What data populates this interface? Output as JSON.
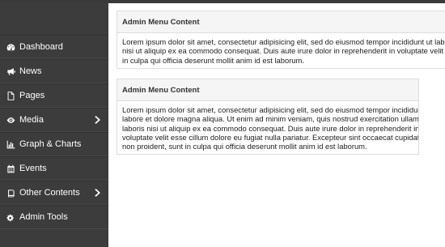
{
  "sidebar": {
    "items": [
      {
        "label": "Dashboard",
        "icon": "dashboard-icon",
        "has_submenu": false
      },
      {
        "label": "News",
        "icon": "bullhorn-icon",
        "has_submenu": false
      },
      {
        "label": "Pages",
        "icon": "file-icon",
        "has_submenu": false
      },
      {
        "label": "Media",
        "icon": "eye-icon",
        "has_submenu": true
      },
      {
        "label": "Graph & Charts",
        "icon": "bar-chart-icon",
        "has_submenu": false
      },
      {
        "label": "Events",
        "icon": "calendar-icon",
        "has_submenu": false
      },
      {
        "label": "Other Contents",
        "icon": "book-icon",
        "has_submenu": true
      },
      {
        "label": "Admin Tools",
        "icon": "cogs-icon",
        "has_submenu": false
      }
    ]
  },
  "panels": [
    {
      "title": "Admin Menu Content",
      "lines": [
        "Lorem ipsum dolor sit amet, consectetur adipisicing elit, sed do eiusmod tempor incididunt ut labore",
        "nisi ut aliquip ex ea commodo consequat. Duis aute irure dolor in reprehenderit in voluptate velit esse",
        "in culpa qui officia deserunt mollit anim id est laborum."
      ]
    },
    {
      "title": "Admin Menu Content",
      "lines": [
        "Lorem ipsum dolor sit amet, consectetur adipisicing elit, sed do eiusmod tempor incididunt ut",
        "labore et dolore magna aliqua. Ut enim ad minim veniam, quis nostrud exercitation ullamco",
        "laboris nisi ut aliquip ex ea commodo consequat. Duis aute irure dolor in reprehenderit in",
        "voluptate velit esse cillum dolore eu fugiat nulla pariatur. Excepteur sint occaecat cupidatat",
        "non proident, sunt in culpa qui officia deserunt mollit anim id est laborum."
      ]
    }
  ],
  "colors": {
    "sidebar_bg": "#3c3c3c",
    "panel_heading_bg": "#f5f5f5",
    "panel_border": "#dddddd"
  }
}
